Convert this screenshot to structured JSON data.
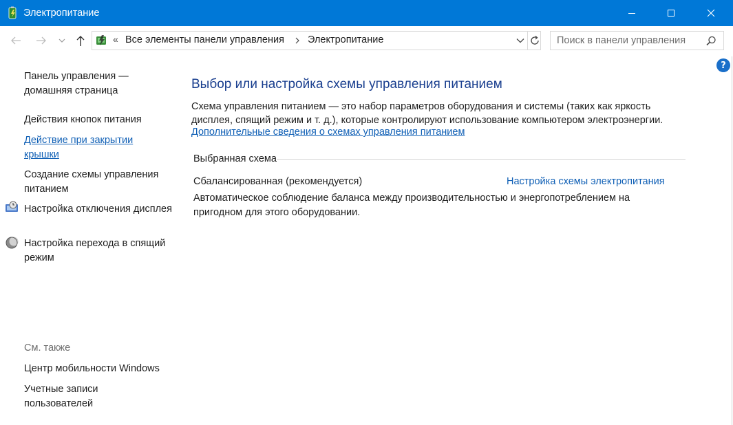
{
  "window": {
    "title": "Электропитание",
    "icon": "power-options-icon",
    "accent": "#0078d7"
  },
  "nav": {
    "back": "arrow-left-icon",
    "forward": "arrow-right-icon",
    "recent": "chevron-down-icon",
    "up": "arrow-up-icon"
  },
  "address": {
    "overflow": "«",
    "crumbs": [
      "Все элементы панели управления",
      "Электропитание"
    ]
  },
  "search": {
    "placeholder": "Поиск в панели управления"
  },
  "help": {
    "label": "?"
  },
  "sidebar": {
    "home": "Панель управления — домашняя страница",
    "items": [
      {
        "label": "Действия кнопок питания"
      },
      {
        "label": "Действие при закрытии крышки"
      },
      {
        "label": "Создание схемы управления питанием"
      },
      {
        "label": "Настройка отключения дисплея"
      },
      {
        "label": "Настройка перехода в спящий режим"
      }
    ],
    "see_also": "См. также",
    "related": [
      {
        "label": "Центр мобильности Windows"
      },
      {
        "label": "Учетные записи пользователей"
      }
    ]
  },
  "main": {
    "heading": "Выбор или настройка схемы управления питанием",
    "description": "Схема управления питанием — это набор параметров оборудования и системы (таких как яркость дисплея, спящий режим и т. д.), которые контролируют использование компьютером электроэнергии.",
    "more_link": "Дополнительные сведения о схемах управления питанием",
    "section_label": "Выбранная схема",
    "plan": {
      "name": "Сбалансированная (рекомендуется)",
      "settings_link": "Настройка схемы электропитания",
      "description": "Автоматическое соблюдение баланса между производительностью и энергопотреблением на пригодном для этого оборудовании."
    }
  }
}
